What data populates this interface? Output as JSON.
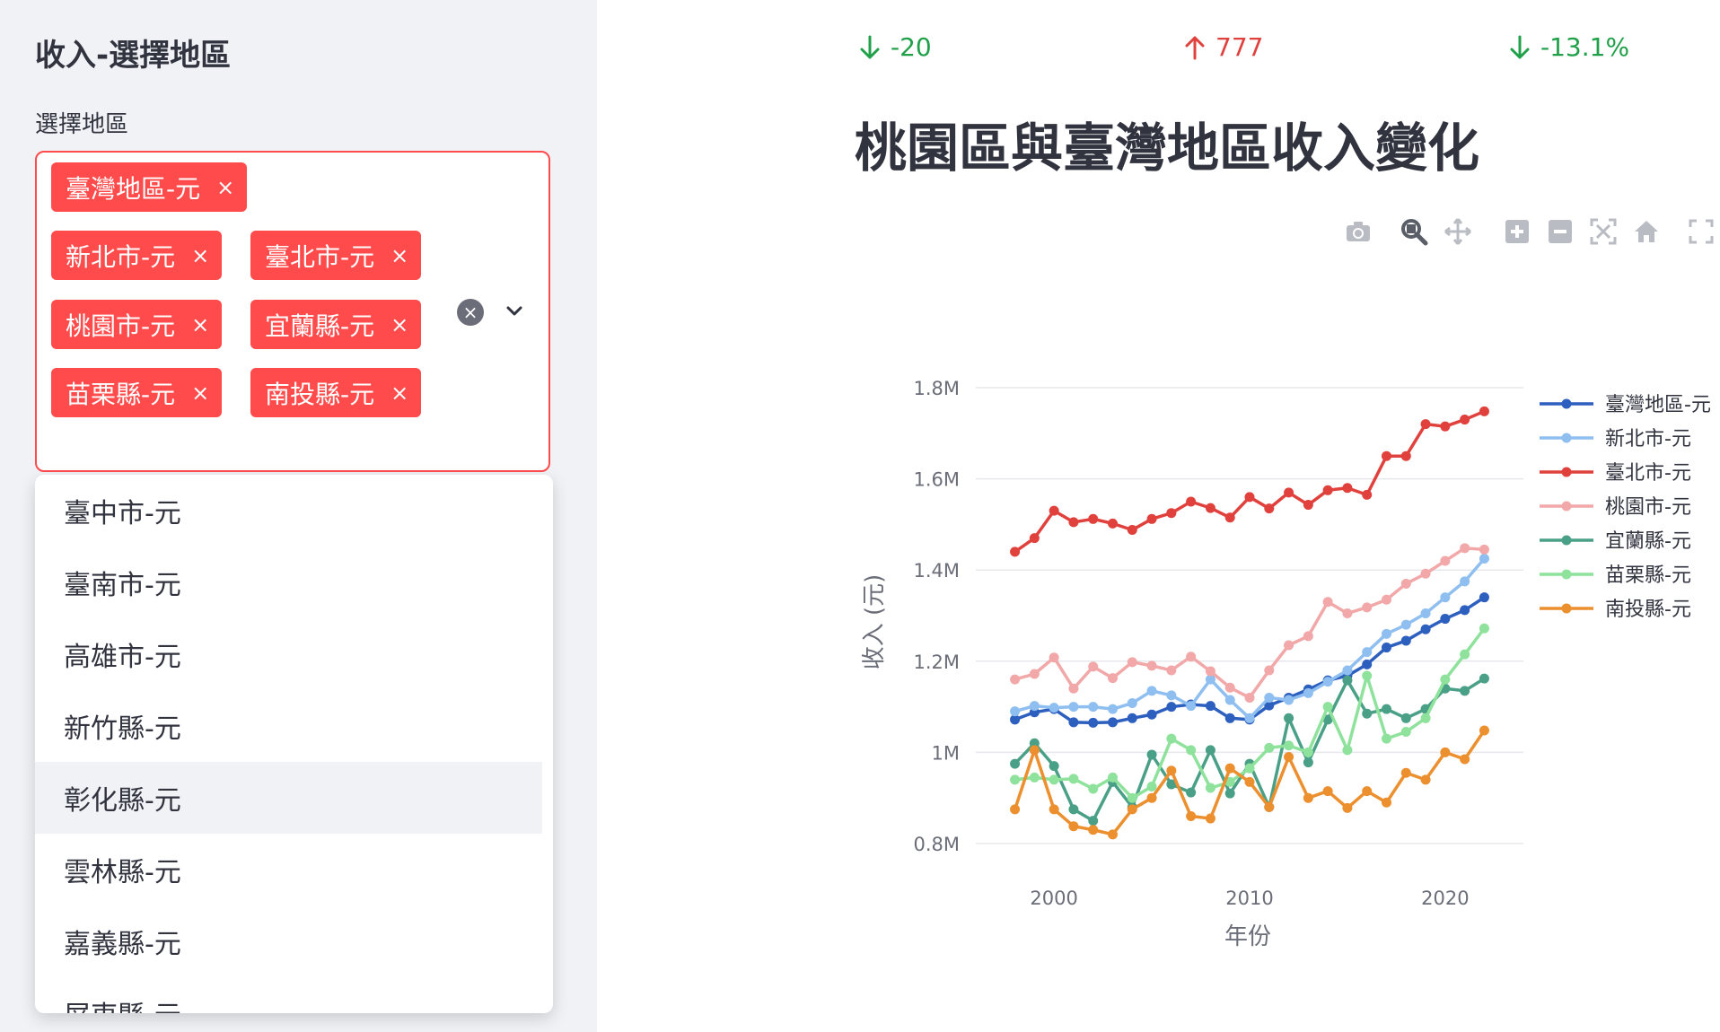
{
  "sidebar": {
    "title": "收入-選擇地區",
    "select_label": "選擇地區",
    "selected": [
      "臺灣地區-元",
      "新北市-元",
      "臺北市-元",
      "桃園市-元",
      "宜蘭縣-元",
      "苗栗縣-元",
      "南投縣-元"
    ],
    "options": [
      "臺中市-元",
      "臺南市-元",
      "高雄市-元",
      "新竹縣-元",
      "彰化縣-元",
      "雲林縣-元",
      "嘉義縣-元",
      "屏東縣-元"
    ],
    "highlighted_option": "彰化縣-元",
    "remove_glyph": "×"
  },
  "metrics": [
    {
      "delta": "-20",
      "direction": "down",
      "color": "#21a04a"
    },
    {
      "delta": "777",
      "direction": "up",
      "color": "#e0413c"
    },
    {
      "delta": "-13.1%",
      "direction": "down",
      "color": "#21a04a"
    }
  ],
  "main": {
    "title": "桃園區與臺灣地區收入變化"
  },
  "toolbar_icons": [
    "camera-icon",
    "zoom-icon",
    "pan-icon",
    "zoom-in-icon",
    "zoom-out-icon",
    "autoscale-icon",
    "home-icon",
    "fullscreen-icon"
  ],
  "chart_data": {
    "type": "line",
    "xlabel": "年份",
    "ylabel": "收入 (元)",
    "xlim": [
      1996,
      2024
    ],
    "ylim": [
      0.8,
      1.8
    ],
    "x_ticks": [
      2000,
      2010,
      2020
    ],
    "x_tick_labels": [
      "2000",
      "2010",
      "2020"
    ],
    "y_ticks": [
      0.8,
      1.0,
      1.2,
      1.4,
      1.6,
      1.8
    ],
    "y_tick_labels": [
      "0.8M",
      "1M",
      "1.2M",
      "1.4M",
      "1.6M",
      "1.8M"
    ],
    "grid": true,
    "legend_position": "right",
    "x": [
      1998,
      1999,
      2000,
      2001,
      2002,
      2003,
      2004,
      2005,
      2006,
      2007,
      2008,
      2009,
      2010,
      2011,
      2012,
      2013,
      2014,
      2015,
      2016,
      2017,
      2018,
      2019,
      2020,
      2021,
      2022
    ],
    "series": [
      {
        "name": "臺灣地區-元",
        "color": "#2d5fbf",
        "values": [
          1.072,
          1.088,
          1.095,
          1.066,
          1.065,
          1.066,
          1.075,
          1.083,
          1.1,
          1.105,
          1.102,
          1.075,
          1.072,
          1.103,
          1.12,
          1.138,
          1.158,
          1.168,
          1.193,
          1.23,
          1.245,
          1.27,
          1.293,
          1.312,
          1.34
        ]
      },
      {
        "name": "新北市-元",
        "color": "#8fbff0",
        "values": [
          1.09,
          1.102,
          1.098,
          1.1,
          1.1,
          1.095,
          1.108,
          1.135,
          1.125,
          1.102,
          1.16,
          1.115,
          1.075,
          1.12,
          1.115,
          1.13,
          1.155,
          1.18,
          1.22,
          1.26,
          1.28,
          1.305,
          1.34,
          1.375,
          1.425
        ]
      },
      {
        "name": "臺北市-元",
        "color": "#e0413c",
        "values": [
          1.44,
          1.47,
          1.53,
          1.505,
          1.512,
          1.502,
          1.488,
          1.512,
          1.525,
          1.55,
          1.536,
          1.515,
          1.56,
          1.535,
          1.57,
          1.543,
          1.575,
          1.58,
          1.565,
          1.65,
          1.65,
          1.72,
          1.715,
          1.73,
          1.748
        ]
      },
      {
        "name": "桃園市-元",
        "color": "#f2a8a8",
        "values": [
          1.16,
          1.172,
          1.208,
          1.14,
          1.188,
          1.163,
          1.198,
          1.19,
          1.18,
          1.21,
          1.178,
          1.142,
          1.12,
          1.18,
          1.235,
          1.255,
          1.33,
          1.305,
          1.318,
          1.335,
          1.37,
          1.392,
          1.42,
          1.448,
          1.445
        ]
      },
      {
        "name": "宜蘭縣-元",
        "color": "#4aa086",
        "values": [
          0.975,
          1.02,
          0.97,
          0.875,
          0.85,
          0.935,
          0.88,
          0.995,
          0.93,
          0.912,
          1.005,
          0.91,
          0.975,
          0.88,
          1.075,
          0.978,
          1.072,
          1.158,
          1.085,
          1.095,
          1.075,
          1.095,
          1.14,
          1.135,
          1.162
        ]
      },
      {
        "name": "苗栗縣-元",
        "color": "#8ee29c",
        "values": [
          0.94,
          0.945,
          0.94,
          0.942,
          0.92,
          0.945,
          0.9,
          0.925,
          1.03,
          1.005,
          0.922,
          0.935,
          0.965,
          1.01,
          1.015,
          1.0,
          1.1,
          1.005,
          1.168,
          1.03,
          1.045,
          1.075,
          1.16,
          1.215,
          1.272
        ]
      },
      {
        "name": "南投縣-元",
        "color": "#ec8f2e",
        "values": [
          0.875,
          1.005,
          0.875,
          0.838,
          0.83,
          0.82,
          0.875,
          0.9,
          0.96,
          0.86,
          0.855,
          0.965,
          0.935,
          0.88,
          0.99,
          0.9,
          0.915,
          0.878,
          0.915,
          0.89,
          0.955,
          0.94,
          1.0,
          0.985,
          1.048
        ]
      }
    ]
  }
}
